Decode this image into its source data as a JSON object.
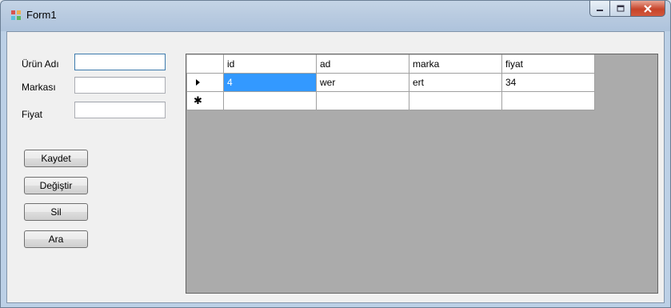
{
  "window": {
    "title": "Form1"
  },
  "form": {
    "labels": {
      "urun_adi": "Ürün Adı",
      "markasi": "Markası",
      "fiyat": "Fiyat"
    },
    "values": {
      "urun_adi": "",
      "markasi": "",
      "fiyat": ""
    }
  },
  "buttons": {
    "kaydet": "Kaydet",
    "degistir": "Değiştir",
    "sil": "Sil",
    "ara": "Ara"
  },
  "grid": {
    "columns": [
      "id",
      "ad",
      "marka",
      "fiyat"
    ],
    "rows": [
      [
        "4",
        "wer",
        "ert",
        "34"
      ]
    ],
    "new_row_marker": "✱"
  },
  "colors": {
    "selection": "#3399ff",
    "grid_background": "#ababab",
    "close_button": "#c7442a"
  }
}
